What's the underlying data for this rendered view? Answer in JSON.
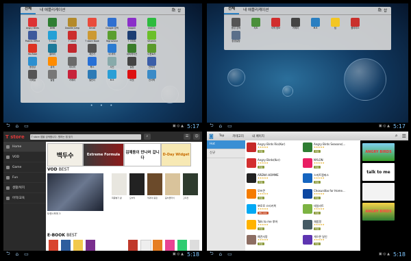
{
  "launcher": {
    "tab_all": "전체",
    "tab_my": "내 애플리케이션",
    "shop": "샵",
    "page_dots": "• • •",
    "clock_1": "5:17",
    "clock_2": "5:17",
    "apps_1": [
      {
        "label": "Angry Birds",
        "color": "#d33"
      },
      {
        "label": "DMB",
        "color": "#2e7d32"
      },
      {
        "label": "Doodle Jump",
        "color": "#b48a2a"
      },
      {
        "label": "Gmail",
        "color": "#e94b3c"
      },
      {
        "label": "Google 검색",
        "color": "#2f6fd0"
      },
      {
        "label": "hoppin",
        "color": "#8b2fc9"
      },
      {
        "label": "melOn",
        "color": "#2dbb3e"
      },
      {
        "label": "",
        "color": ""
      },
      {
        "label": "Polaris Office",
        "color": "#3d5a9c"
      },
      {
        "label": "T map",
        "color": "#23a0d6"
      },
      {
        "label": "T store",
        "color": "#cc2d2d"
      },
      {
        "label": "T store Book",
        "color": "#c93"
      },
      {
        "label": "TegraZone",
        "color": "#5a9e2f"
      },
      {
        "label": "T 스마트",
        "color": "#1c3d72"
      },
      {
        "label": "Vitamin",
        "color": "#6bbf2a"
      },
      {
        "label": "",
        "color": ""
      },
      {
        "label": "YouTube",
        "color": "#d32"
      },
      {
        "label": "갤러리",
        "color": "#1d7a9a"
      },
      {
        "label": "",
        "color": "#c1272d"
      },
      {
        "label": "계산기",
        "color": "#555"
      },
      {
        "label": "내 위치",
        "color": "#2b7bd1"
      },
      {
        "label": "내비게이션",
        "color": "#3a7d2a"
      },
      {
        "label": "다운로드",
        "color": "#5b9b2b"
      },
      {
        "label": "",
        "color": ""
      },
      {
        "label": "동영상",
        "color": "#2b8fd0"
      },
      {
        "label": "뮤직",
        "color": "#ff8c00"
      },
      {
        "label": "미디어",
        "color": "#6a6a6a"
      },
      {
        "label": "북스",
        "color": "#2770d6"
      },
      {
        "label": "사진",
        "color": "#8aa"
      },
      {
        "label": "설정",
        "color": "#444"
      },
      {
        "label": "연락처",
        "color": "#3b5ea8"
      },
      {
        "label": "",
        "color": ""
      },
      {
        "label": "이메일",
        "color": "#555"
      },
      {
        "label": "알람",
        "color": "#777"
      },
      {
        "label": "카메라",
        "color": "#c7223a"
      },
      {
        "label": "캘린더",
        "color": "#2c7bb6"
      },
      {
        "label": "토크",
        "color": "#2a9fd6"
      },
      {
        "label": "마켓",
        "color": "#d11"
      },
      {
        "label": "전자책",
        "color": "#3a8bc7"
      },
      {
        "label": "",
        "color": ""
      }
    ],
    "apps_2": [
      {
        "label": "음성 검색",
        "color": "#555"
      },
      {
        "label": "지도",
        "color": "#4a8f3a"
      },
      {
        "label": "지역 정보",
        "color": "#d12d2d"
      },
      {
        "label": "카메라",
        "color": "#444"
      },
      {
        "label": "토크",
        "color": "#2a7fc1"
      },
      {
        "label": "팁",
        "color": "#f3c623"
      },
      {
        "label": "폴라리스",
        "color": "#c9302c"
      },
      {
        "label": "",
        "color": ""
      },
      {
        "label": "환경설정",
        "color": "#5a6f8a"
      }
    ]
  },
  "tstore": {
    "logo": "T store",
    "search_placeholder": "T store 앱을 검색합니다. 원하는 앱 찾기",
    "sidebar": [
      "Home",
      "VOD",
      "Game",
      "Fun",
      "생활/위치",
      "어학/교육"
    ],
    "banners": [
      "백두수",
      "Extreme Formula",
      "김제동이 만나러 갑니다",
      "D-Day Widget"
    ],
    "vod_title_1": "VOD",
    "vod_title_2": "BEST",
    "vod_caption": "트랜스포머 3",
    "vod_posters": [
      {
        "label": "최종병기 활",
        "color": "#e8e6df"
      },
      {
        "label": "모비딕",
        "color": "#222"
      },
      {
        "label": "적과의 동침",
        "color": "#6b4a2a"
      },
      {
        "label": "음치클리닉",
        "color": "#d9c39b"
      },
      {
        "label": "고지전",
        "color": "#2e3b2e"
      }
    ],
    "ebook_title_1": "E-BOOK",
    "ebook_title_2": "BEST",
    "clock": "5:18"
  },
  "market": {
    "tabs": [
      "Top",
      "카테고리",
      "내 페이지"
    ],
    "categories": [
      "Hot",
      "신규"
    ],
    "apps": [
      {
        "name": "Angry Birds Rio(Kor)",
        "price": "무료",
        "color": "#c62828",
        "paid": false
      },
      {
        "name": "Angry Birds Seasons(...",
        "price": "무료",
        "color": "#2e7d32",
        "paid": false
      },
      {
        "name": "Angry Birds(Kor)",
        "price": "무료",
        "color": "#d32f2f",
        "paid": false
      },
      {
        "name": "NYLON",
        "price": "무료",
        "color": "#e91e63",
        "paid": false
      },
      {
        "name": "ARENA HOMME",
        "price": "무료",
        "color": "#222",
        "paid": false
      },
      {
        "name": "스마트캠퍼스",
        "price": "무료",
        "color": "#1565c0",
        "paid": false
      },
      {
        "name": "모프콘",
        "price": "무료",
        "color": "#f57c00",
        "paid": false
      },
      {
        "name": "Chosunilbo for Home...",
        "price": "무료",
        "color": "#0d47a1",
        "paid": false
      },
      {
        "name": "뽀로로 스티커북",
        "price": "₩2,000",
        "color": "#03a9f4",
        "paid": true
      },
      {
        "name": "데일리트",
        "price": "무료",
        "color": "#7cb342",
        "paid": false
      },
      {
        "name": "Talk to me 뿌까",
        "price": "무료",
        "color": "#ffb300",
        "paid": false
      },
      {
        "name": "채범펑",
        "price": "무료",
        "color": "#455a64",
        "paid": false
      },
      {
        "name": "예견사랑",
        "price": "무료",
        "color": "#8d6e63",
        "paid": false
      },
      {
        "name": "게으른 달인",
        "price": "무료",
        "color": "#5e35b1",
        "paid": false
      }
    ],
    "ads": [
      "ANGRY BIRDS",
      "talk to me",
      "",
      "ANGRY BIRDS"
    ],
    "clock": "5:18"
  }
}
